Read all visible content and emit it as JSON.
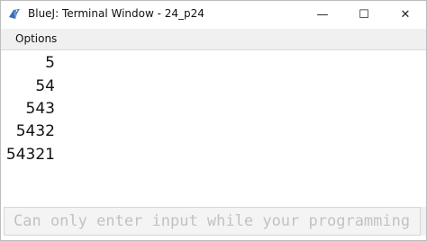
{
  "window": {
    "title": "BlueJ: Terminal Window - 24_p24",
    "minimize_glyph": "—",
    "maximize_glyph": "☐",
    "close_glyph": "✕"
  },
  "menu": {
    "options_label": "Options"
  },
  "output": {
    "lines": [
      "5",
      "54",
      "543",
      "5432",
      "54321"
    ]
  },
  "input": {
    "placeholder": "Can only enter input while your programming is running",
    "value": ""
  },
  "icons": {
    "app_icon": "bluej-bird-icon"
  },
  "colors": {
    "titlebar": "#ffffff",
    "menubar": "#f0f0f0",
    "input_bg": "#f4f4f4",
    "placeholder_text": "#c2c2c2"
  }
}
